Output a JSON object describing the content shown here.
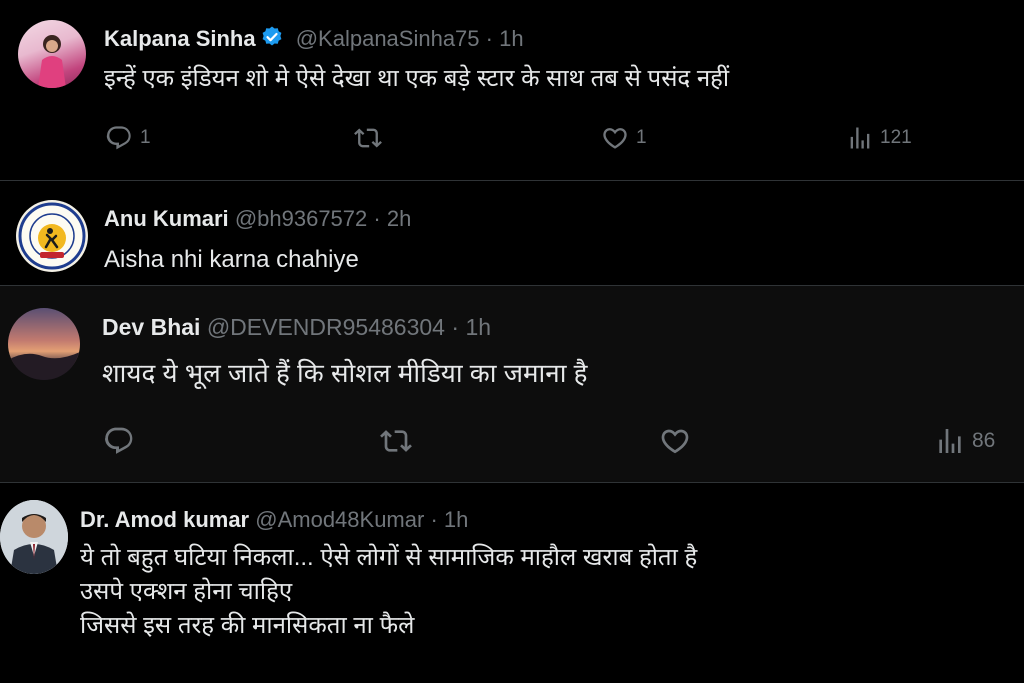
{
  "tweets": [
    {
      "name": "Kalpana Sinha",
      "handle": "@KalpanaSinha75",
      "separator": "·",
      "time": "1h",
      "text": [
        "इन्हें एक इंडियन शो मे ऐसे देखा था एक बड़े स्टार के साथ तब से पसंद नहीं"
      ],
      "verified": true,
      "reply_count": "1",
      "retweet_count": "",
      "like_count": "1",
      "view_count": "121"
    },
    {
      "name": "Anu Kumari",
      "handle": "@bh9367572",
      "separator": "·",
      "time": "2h",
      "text": [
        "Aisha nhi karna chahiye"
      ],
      "verified": false
    },
    {
      "name": "Dev Bhai",
      "handle": "@DEVENDR95486304",
      "separator": "·",
      "time": "1h",
      "text": [
        "शायद ये भूल जाते हैं कि सोशल मीडिया का जमाना है"
      ],
      "verified": false,
      "reply_count": "",
      "retweet_count": "",
      "like_count": "",
      "view_count": "86"
    },
    {
      "name": "Dr. Amod kumar",
      "handle": "@Amod48Kumar",
      "separator": "·",
      "time": "1h",
      "text": [
        "ये तो बहुत घटिया निकला... ऐसे लोगों से सामाजिक माहौल खराब होता है",
        "उसपे एक्शन होना चाहिए",
        "जिससे इस तरह की मानसिकता ना फैले"
      ],
      "verified": false
    }
  ],
  "colors": {
    "background": "#000000",
    "text": "#e7e9ea",
    "muted": "#71767b",
    "verified": "#1d9bf0",
    "divider": "#2f3336"
  },
  "icons": [
    "reply-icon",
    "retweet-icon",
    "like-icon",
    "views-icon",
    "verified-badge-icon"
  ]
}
